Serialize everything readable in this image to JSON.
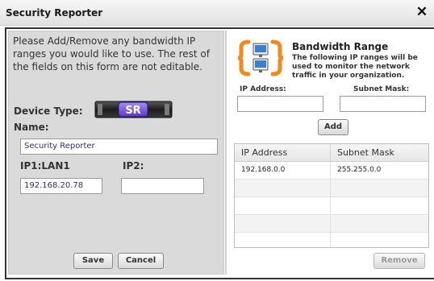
{
  "dialog": {
    "title": "Security Reporter",
    "close_glyph": "✕",
    "close_icon": "close-icon"
  },
  "left": {
    "intro": "Please Add/Remove any bandwidth IP ranges you would like to use.  The rest of the fields on this form are not editable.",
    "device_type_label": "Device Type:",
    "device_badge_text": "SR",
    "device_icon": "server-appliance-icon",
    "name_label": "Name:",
    "name_value": "Security Reporter",
    "ip1_label": "IP1:LAN1",
    "ip1_value": "192.168.20.78",
    "ip2_label": "IP2:",
    "ip2_value": "",
    "save_label": "Save",
    "cancel_label": "Cancel"
  },
  "right": {
    "icon": "network-range-icon",
    "title": "Bandwidth Range",
    "description": "The following IP ranges will be used to monitor the network traffic in your organization.",
    "ip_label": "IP Address:",
    "mask_label": "Subnet Mask:",
    "ip_value": "",
    "mask_value": "",
    "add_label": "Add",
    "remove_label": "Remove",
    "grid": {
      "columns": [
        "IP Address",
        "Subnet Mask"
      ],
      "rows": [
        [
          "192.168.0.0",
          "255.255.0.0"
        ],
        [
          "",
          ""
        ],
        [
          "",
          ""
        ],
        [
          "",
          ""
        ],
        [
          "",
          ""
        ]
      ]
    }
  },
  "colors": {
    "accent_orange": "#f08a1c",
    "device_purple": "#6b4bc8",
    "field_text": "#3a2a7a"
  }
}
